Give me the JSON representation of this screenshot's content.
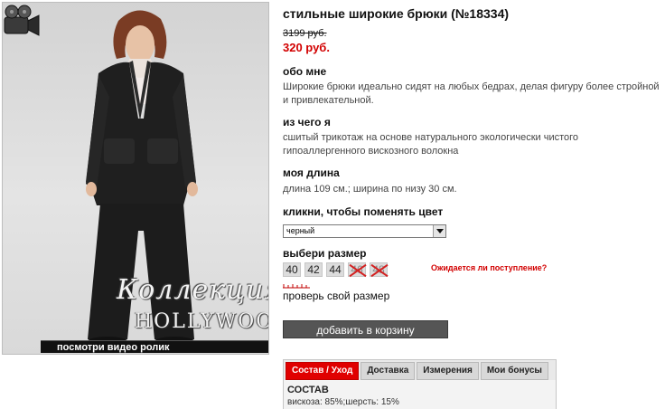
{
  "product": {
    "title": "стильные широкие брюки (№18334)",
    "old_price": "3199 руб.",
    "new_price": "320 руб."
  },
  "photo": {
    "collection_script": "Коллекция",
    "collection_brand": "HOLLYWOOD",
    "video_link": "посмотри видео ролик"
  },
  "about": {
    "heading": "обо мне",
    "text": "Широкие брюки идеально сидят на любых бедрах, делая фигуру более стройной и привлекательной."
  },
  "material": {
    "heading": "из чего я",
    "text": "сшитый трикотаж на основе натурального экологически чистого гипоаллергенного вискозного волокна"
  },
  "length": {
    "heading": "моя длина",
    "text": "длина 109 см.; ширина по низу 30 см."
  },
  "color": {
    "heading": "кликни, чтобы поменять цвет",
    "selected": "черный"
  },
  "size": {
    "heading": "выбери размер",
    "options": [
      {
        "label": "40",
        "available": true
      },
      {
        "label": "42",
        "available": true
      },
      {
        "label": "44",
        "available": true
      },
      {
        "label": "46",
        "available": false
      },
      {
        "label": "48",
        "available": false
      }
    ],
    "notify_link": "Ожидается ли поступление?",
    "check_size_link": "проверь свой размер"
  },
  "cart": {
    "button_label": "добавить в корзину"
  },
  "tabs": {
    "items": [
      "Состав / Уход",
      "Доставка",
      "Измерения",
      "Мои бонусы"
    ],
    "active_index": 0,
    "content_title": "СОСТАВ",
    "content_text": "вискоза: 85%;шерсть: 15%"
  },
  "colors": {
    "accent_red": "#d20000",
    "button_gray": "#555555"
  }
}
